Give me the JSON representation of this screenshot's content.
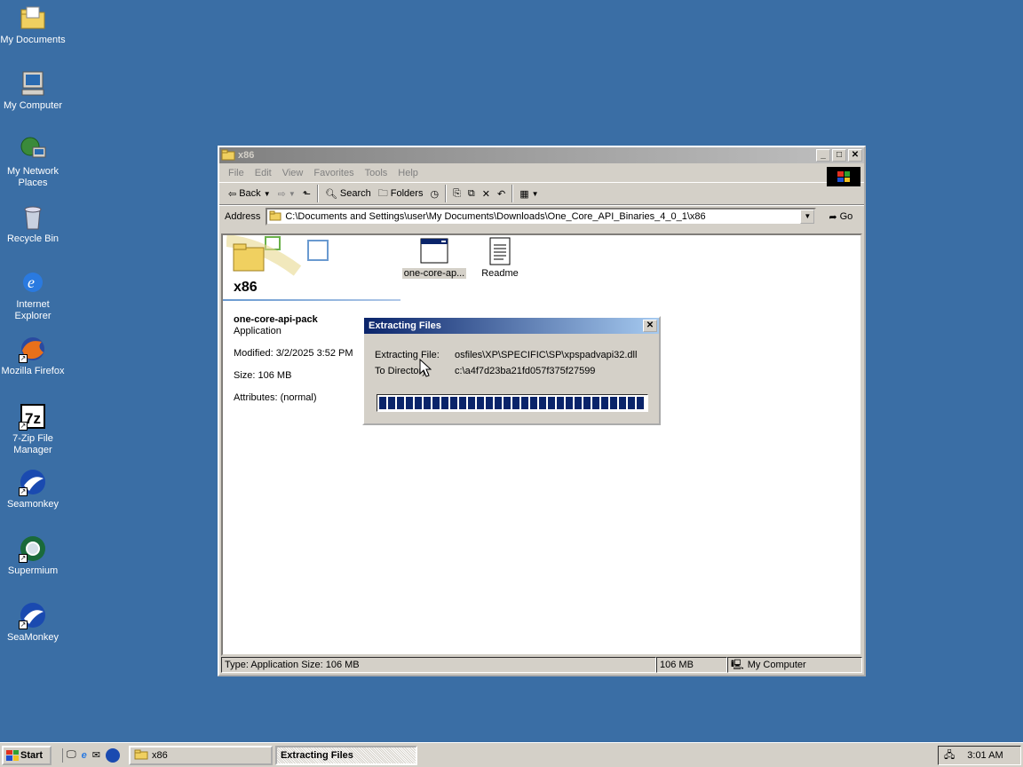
{
  "desktop": {
    "icons": [
      {
        "label": "My Documents"
      },
      {
        "label": "My Computer"
      },
      {
        "label": "My Network Places"
      },
      {
        "label": "Recycle Bin"
      },
      {
        "label": "Internet Explorer"
      },
      {
        "label": "Mozilla Firefox"
      },
      {
        "label": "7-Zip File Manager"
      },
      {
        "label": "Seamonkey"
      },
      {
        "label": "Supermium"
      },
      {
        "label": "SeaMonkey"
      }
    ]
  },
  "explorer": {
    "title": "x86",
    "menu": [
      "File",
      "Edit",
      "View",
      "Favorites",
      "Tools",
      "Help"
    ],
    "toolbar": {
      "back": "Back",
      "search": "Search",
      "folders": "Folders"
    },
    "address": {
      "label": "Address",
      "path": "C:\\Documents and Settings\\user\\My Documents\\Downloads\\One_Core_API_Binaries_4_0_1\\x86",
      "go": "Go"
    },
    "folder_heading": "x86",
    "selected": {
      "name": "one-core-api-pack",
      "type": "Application",
      "modified": "Modified: 3/2/2025 3:52 PM",
      "size": "Size: 106 MB",
      "attributes": "Attributes: (normal)"
    },
    "files": [
      {
        "label": "one-core-ap..."
      },
      {
        "label": "Readme"
      }
    ],
    "status": {
      "left": "Type: Application Size: 106 MB",
      "size": "106 MB",
      "zone": "My Computer"
    }
  },
  "dialog": {
    "title": "Extracting Files",
    "extracting_label": "Extracting File:",
    "extracting_value": "osfiles\\XP\\SPECIFIC\\SP\\xpspadvapi32.dll",
    "directory_label": "To Directory:",
    "directory_value": "c:\\a4f7d23ba21fd057f375f27599",
    "progress": 1.0
  },
  "taskbar": {
    "start": "Start",
    "tasks": [
      {
        "label": "x86"
      },
      {
        "label": "Extracting Files"
      }
    ],
    "clock": "3:01 AM"
  }
}
